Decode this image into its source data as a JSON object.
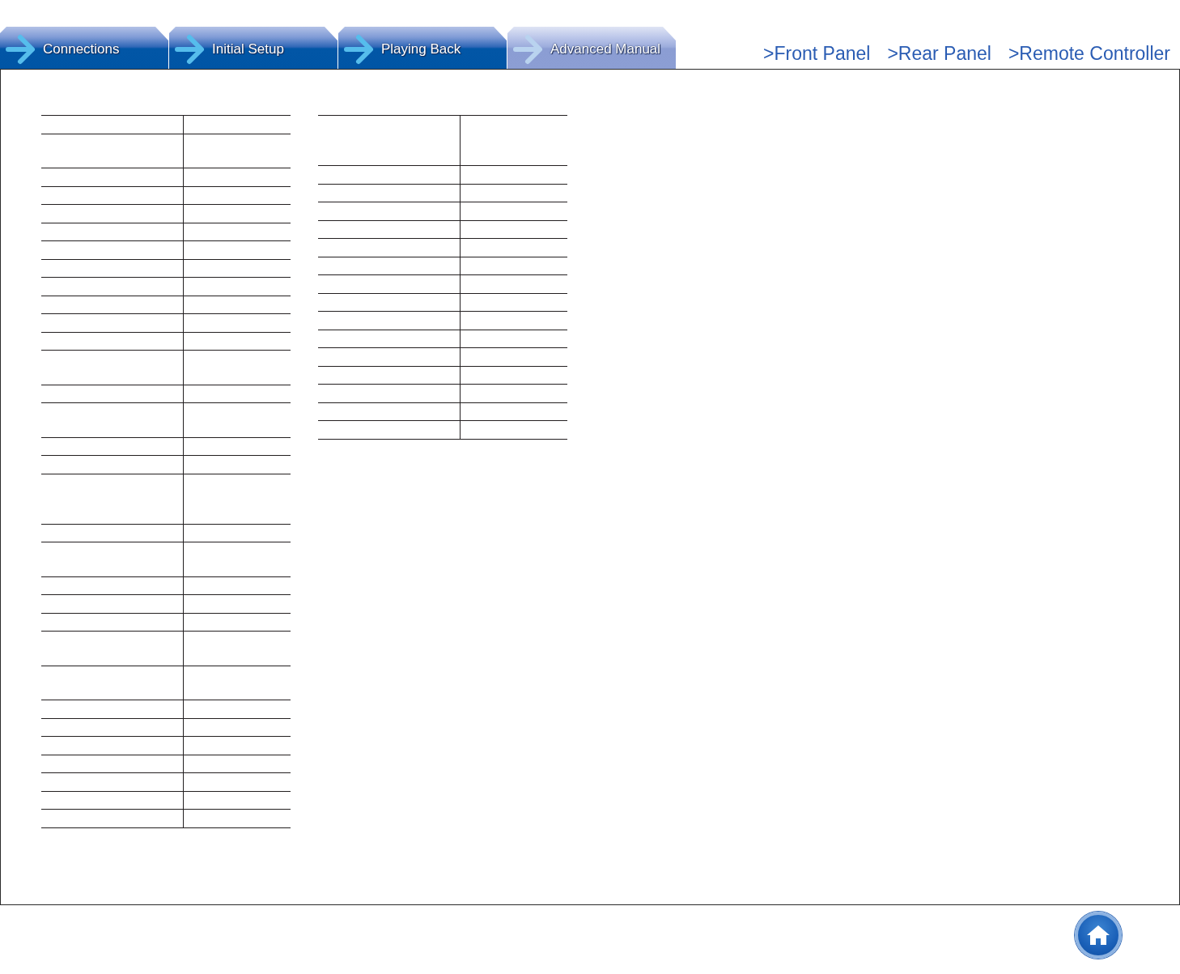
{
  "tabs": [
    {
      "label": "Connections",
      "selected": false
    },
    {
      "label": "Initial Setup",
      "selected": false
    },
    {
      "label": "Playing Back",
      "selected": false
    },
    {
      "label": "Advanced Manual",
      "selected": true
    }
  ],
  "links": [
    ">Front Panel",
    ">Rear Panel",
    ">Remote Controller"
  ],
  "tables": [
    {
      "rows": [
        {
          "kind": "single"
        },
        {
          "kind": "double"
        },
        {
          "kind": "single"
        },
        {
          "kind": "single"
        },
        {
          "kind": "single"
        },
        {
          "kind": "single"
        },
        {
          "kind": "single"
        },
        {
          "kind": "single"
        },
        {
          "kind": "single"
        },
        {
          "kind": "single"
        },
        {
          "kind": "single"
        },
        {
          "kind": "single"
        },
        {
          "kind": "double"
        },
        {
          "kind": "single"
        },
        {
          "kind": "double"
        },
        {
          "kind": "single"
        },
        {
          "kind": "single"
        },
        {
          "kind": "triple"
        },
        {
          "kind": "single"
        },
        {
          "kind": "double"
        },
        {
          "kind": "single"
        },
        {
          "kind": "single"
        },
        {
          "kind": "single"
        },
        {
          "kind": "double"
        },
        {
          "kind": "double"
        },
        {
          "kind": "single"
        },
        {
          "kind": "single"
        },
        {
          "kind": "single"
        },
        {
          "kind": "single"
        },
        {
          "kind": "single"
        },
        {
          "kind": "single"
        },
        {
          "kind": "single"
        }
      ]
    },
    {
      "rows": [
        {
          "kind": "triple"
        },
        {
          "kind": "single"
        },
        {
          "kind": "single"
        },
        {
          "kind": "single"
        },
        {
          "kind": "single"
        },
        {
          "kind": "single"
        },
        {
          "kind": "single"
        },
        {
          "kind": "single"
        },
        {
          "kind": "single"
        },
        {
          "kind": "single"
        },
        {
          "kind": "single"
        },
        {
          "kind": "single"
        },
        {
          "kind": "single"
        },
        {
          "kind": "single"
        },
        {
          "kind": "single"
        },
        {
          "kind": "single"
        }
      ]
    }
  ]
}
